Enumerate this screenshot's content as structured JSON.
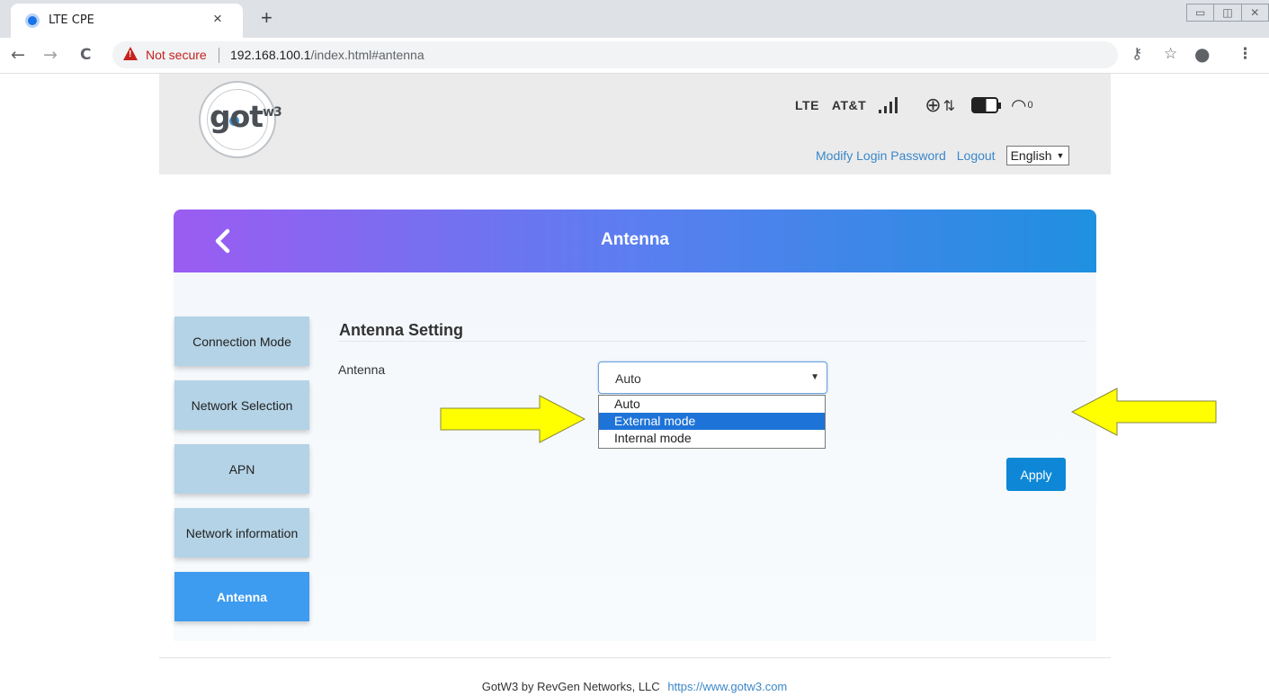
{
  "browser": {
    "tab_title": "LTE CPE",
    "tab_close": "×",
    "new_tab": "+",
    "window_controls": [
      "▭",
      "◫",
      "✕"
    ],
    "back": "←",
    "forward": "→",
    "reload": "C",
    "security_label": "Not secure",
    "url_host": "192.168.100.1",
    "url_path": "/index.html#antenna",
    "toolbar_icons": [
      "key-icon",
      "star-icon",
      "profile-icon",
      "menu-icon"
    ]
  },
  "header": {
    "logo_text": "got",
    "logo_sup": "w3",
    "network_type": "LTE",
    "carrier": "AT&T",
    "signal_level": 4,
    "wifi_clients": "0",
    "links": {
      "modify_password": "Modify Login Password",
      "logout": "Logout"
    },
    "language": "English"
  },
  "card": {
    "title": "Antenna",
    "back_icon": "chevron-left-icon"
  },
  "sidebar": {
    "items": [
      {
        "label": "Connection Mode",
        "active": false
      },
      {
        "label": "Network Selection",
        "active": false
      },
      {
        "label": "APN",
        "active": false
      },
      {
        "label": "Network information",
        "active": false
      },
      {
        "label": "Antenna",
        "active": true
      }
    ]
  },
  "antenna_setting": {
    "section_title": "Antenna Setting",
    "field_label": "Antenna",
    "selected_value": "Auto",
    "options": [
      "Auto",
      "External mode",
      "Internal mode"
    ],
    "highlighted_option": "External mode",
    "apply_label": "Apply"
  },
  "annotations": {
    "arrow_color": "#ffff00"
  },
  "footer": {
    "text": "GotW3 by RevGen Networks, LLC",
    "link": "https://www.gotw3.com"
  },
  "colors": {
    "header_gradient_start": "#9b5cf1",
    "header_gradient_end": "#1f90e0",
    "sidebar_inactive": "#b4d3e6",
    "sidebar_active": "#3d9bf0",
    "apply_button": "#0e88d6",
    "link": "#3b87c9"
  }
}
